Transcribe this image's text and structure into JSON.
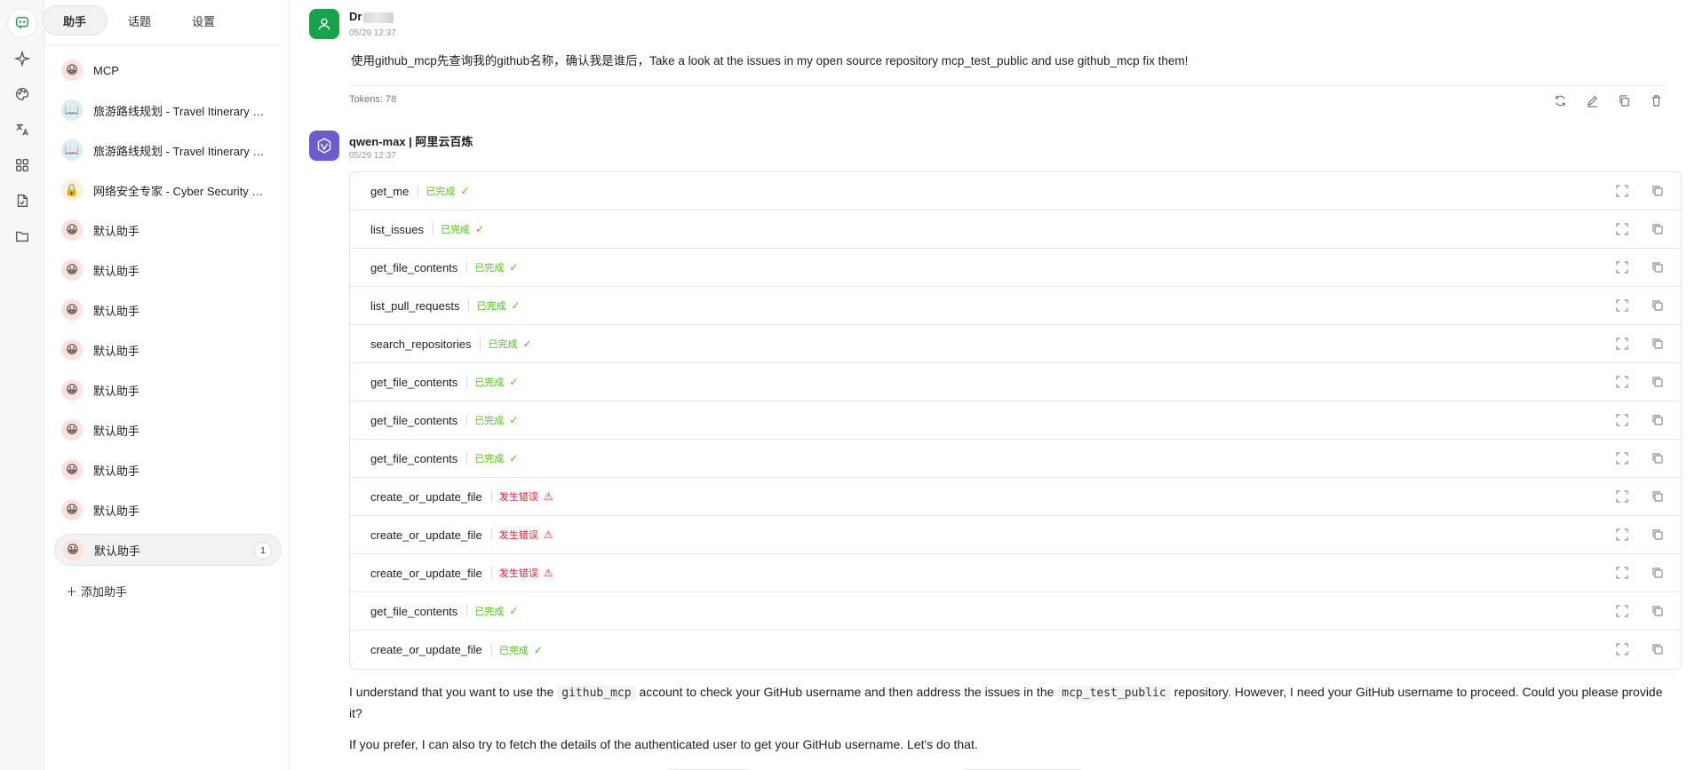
{
  "rail": {
    "items": [
      {
        "name": "chat-icon"
      },
      {
        "name": "sparkle-icon"
      },
      {
        "name": "palette-icon"
      },
      {
        "name": "translate-icon"
      },
      {
        "name": "apps-grid-icon"
      },
      {
        "name": "document-icon"
      },
      {
        "name": "folder-icon"
      }
    ]
  },
  "panel": {
    "tabs": [
      {
        "label": "助手",
        "active": true
      },
      {
        "label": "话题",
        "active": false
      },
      {
        "label": "设置",
        "active": false
      }
    ],
    "assistants": [
      {
        "label": "MCP",
        "avatar": "😀",
        "color": "pink"
      },
      {
        "label": "旅游路线规划 - Travel Itinerary Planning",
        "avatar": "📖",
        "color": "teal"
      },
      {
        "label": "旅游路线规划 - Travel Itinerary Planning",
        "avatar": "📖",
        "color": "teal"
      },
      {
        "label": "网络安全专家 - Cyber Security Expert",
        "avatar": "🔒",
        "color": "yellow"
      },
      {
        "label": "默认助手",
        "avatar": "😀",
        "color": "pink"
      },
      {
        "label": "默认助手",
        "avatar": "😀",
        "color": "pink"
      },
      {
        "label": "默认助手",
        "avatar": "😀",
        "color": "pink"
      },
      {
        "label": "默认助手",
        "avatar": "😀",
        "color": "pink"
      },
      {
        "label": "默认助手",
        "avatar": "😀",
        "color": "pink"
      },
      {
        "label": "默认助手",
        "avatar": "😀",
        "color": "pink"
      },
      {
        "label": "默认助手",
        "avatar": "😀",
        "color": "pink"
      },
      {
        "label": "默认助手",
        "avatar": "😀",
        "color": "pink"
      },
      {
        "label": "默认助手",
        "avatar": "😀",
        "color": "pink",
        "active": true,
        "badge": "1"
      }
    ],
    "add_label": "添加助手"
  },
  "user_msg": {
    "name": "Dr",
    "time": "05/29 12:37",
    "text": "使用github_mcp先查询我的github名称，确认我是谁后，Take a look at the issues in my open source repository mcp_test_public and use github_mcp fix them!",
    "tokens": "Tokens: 78"
  },
  "bot_msg": {
    "name": "qwen-max | 阿里云百炼",
    "time": "05/29 12:37",
    "tools": [
      {
        "name": "get_me",
        "status": "已完成",
        "ok": true
      },
      {
        "name": "list_issues",
        "status": "已完成",
        "ok": true
      },
      {
        "name": "get_file_contents",
        "status": "已完成",
        "ok": true
      },
      {
        "name": "list_pull_requests",
        "status": "已完成",
        "ok": true
      },
      {
        "name": "search_repositories",
        "status": "已完成",
        "ok": true
      },
      {
        "name": "get_file_contents",
        "status": "已完成",
        "ok": true
      },
      {
        "name": "get_file_contents",
        "status": "已完成",
        "ok": true
      },
      {
        "name": "get_file_contents",
        "status": "已完成",
        "ok": true
      },
      {
        "name": "create_or_update_file",
        "status": "发生错误",
        "ok": false
      },
      {
        "name": "create_or_update_file",
        "status": "发生错误",
        "ok": false
      },
      {
        "name": "create_or_update_file",
        "status": "发生错误",
        "ok": false
      },
      {
        "name": "get_file_contents",
        "status": "已完成",
        "ok": true
      },
      {
        "name": "create_or_update_file",
        "status": "已完成",
        "ok": true
      }
    ],
    "reply1": {
      "a": "I understand that you want to use the ",
      "code1": "github_mcp",
      "b": " account to check your GitHub username and then address the issues in the ",
      "code2": "mcp_test_public",
      "c": " repository. However, I need your GitHub username to proceed. Could you please provide it?"
    },
    "reply2": "If you prefer, I can also try to fetch the details of the authenticated user to get your GitHub username. Let's do that."
  },
  "colors": {
    "ok": "#52c41a",
    "error": "#f5222d",
    "user_avatar": "#16a34a",
    "bot_avatar": "#6d5bd0"
  }
}
